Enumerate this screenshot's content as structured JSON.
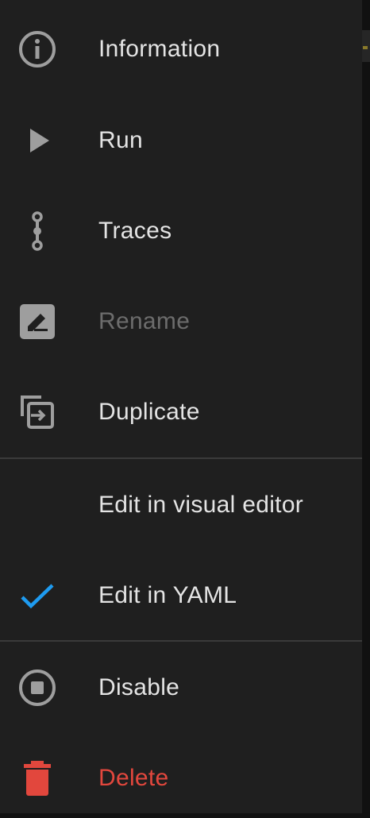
{
  "menu": {
    "items": [
      {
        "label": "Information",
        "icon": "info-icon",
        "state": "enabled"
      },
      {
        "label": "Run",
        "icon": "play-icon",
        "state": "enabled"
      },
      {
        "label": "Traces",
        "icon": "traces-icon",
        "state": "enabled"
      },
      {
        "label": "Rename",
        "icon": "rename-icon",
        "state": "disabled"
      },
      {
        "label": "Duplicate",
        "icon": "duplicate-icon",
        "state": "enabled"
      },
      {
        "label": "Edit in visual editor",
        "icon": "",
        "state": "enabled"
      },
      {
        "label": "Edit in YAML",
        "icon": "check-icon",
        "state": "selected"
      },
      {
        "label": "Disable",
        "icon": "stop-circle-icon",
        "state": "enabled"
      },
      {
        "label": "Delete",
        "icon": "trash-icon",
        "state": "danger"
      }
    ]
  },
  "colors": {
    "menu_background": "#1f1f1f",
    "text": "#e4e4e4",
    "disabled_text": "#6c6c6c",
    "icon": "#9e9e9e",
    "check": "#1e9bf0",
    "danger": "#e2473d",
    "divider": "#3a3a3a"
  }
}
